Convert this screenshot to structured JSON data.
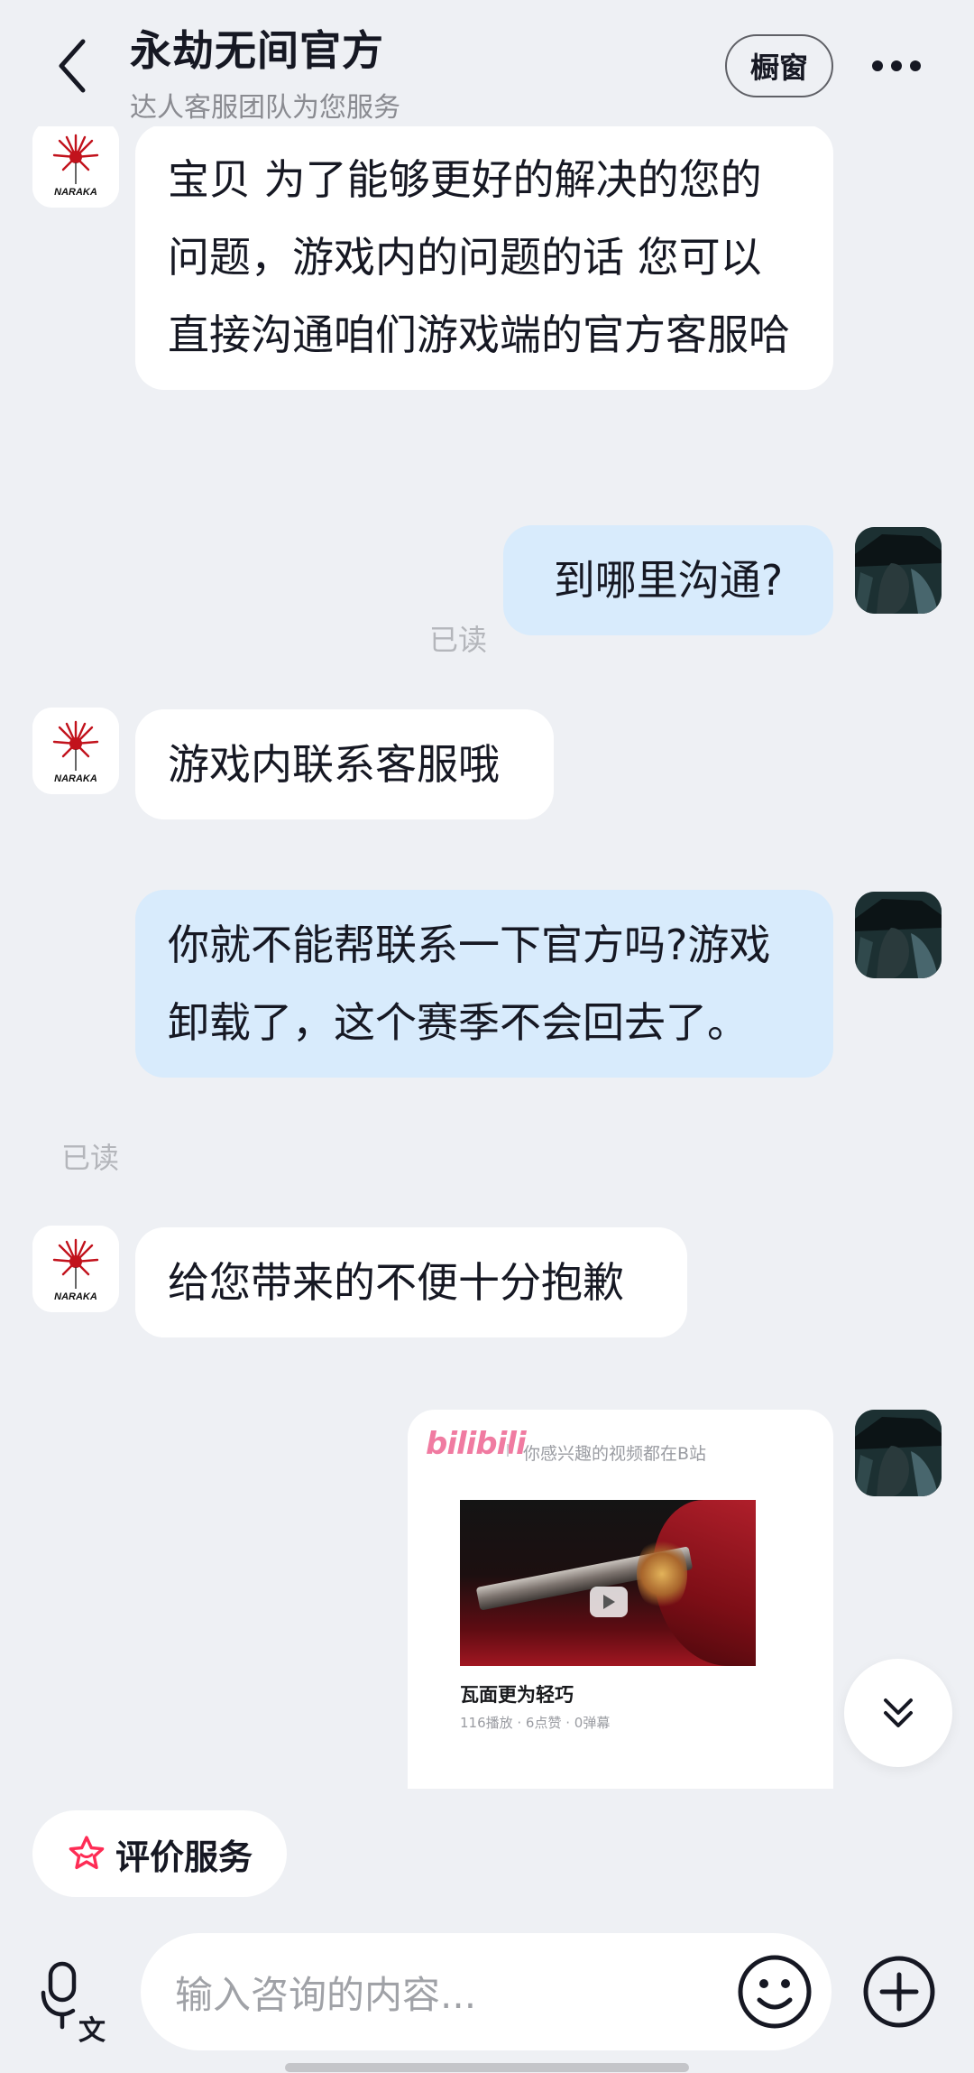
{
  "header": {
    "title": "永劫无间官方",
    "subtitle": "达人客服团队为您服务",
    "showcase_label": "橱窗"
  },
  "messages": [
    {
      "sender": "shop",
      "text": "宝贝 为了能够更好的解决的您的问题，游戏内的问题的话  您可以直接沟通咱们游戏端的官方客服哈"
    },
    {
      "sender": "user",
      "text": "到哪里沟通?",
      "status": "已读"
    },
    {
      "sender": "shop",
      "text": "游戏内联系客服哦"
    },
    {
      "sender": "user",
      "text": "你就不能帮联系一下官方吗?游戏卸载了，这个赛季不会回去了。",
      "status": "已读"
    },
    {
      "sender": "shop",
      "text": "给您带来的不便十分抱歉"
    }
  ],
  "video_card": {
    "brand": "bilibili",
    "tagline": "你感兴趣的视频都在B站",
    "title": "瓦面更为轻巧",
    "stats": "116播放 · 6点赞 · 0弹幕"
  },
  "rate_button": {
    "label": "评价服务"
  },
  "input": {
    "placeholder": "输入咨询的内容..."
  },
  "colors": {
    "background": "#eef0f4",
    "shop_bubble": "#ffffff",
    "user_bubble": "#d8ebfc",
    "accent_pink": "#fe2c55"
  },
  "icons": [
    "back-arrow-icon",
    "more-icon",
    "chevron-double-down-icon",
    "star-icon",
    "voice-translate-icon",
    "emoji-icon",
    "plus-icon",
    "play-icon"
  ]
}
